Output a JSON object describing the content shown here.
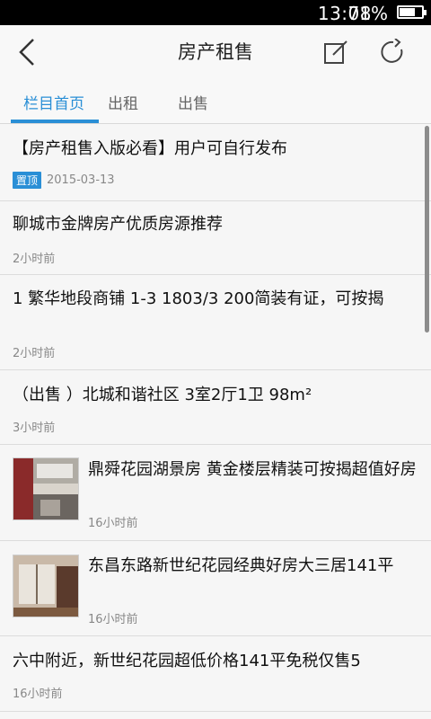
{
  "status_bar": {
    "time": "13:08",
    "battery_percent": "71%",
    "battery_level": 0.71
  },
  "app_bar": {
    "title": "房产租售",
    "back_icon": "back-arrow-icon",
    "compose_icon": "compose-icon",
    "refresh_icon": "refresh-icon"
  },
  "tabs": [
    {
      "label": "栏目首页",
      "active": true
    },
    {
      "label": "出租",
      "active": false
    },
    {
      "label": "出售",
      "active": false
    }
  ],
  "posts": [
    {
      "title": "【房产租售入版必看】用户可自行发布",
      "badge": "置顶",
      "time": "2015-03-13"
    },
    {
      "title": "聊城市金牌房产优质房源推荐",
      "time": "2小时前"
    },
    {
      "title": "1 繁华地段商铺  1-3 1803/3 200简装有证，可按揭",
      "time": "2小时前"
    },
    {
      "title": "（出售 ）北城和谐社区 3室2厅1卫 98m²",
      "time": "3小时前"
    },
    {
      "title": "鼎舜花园湖景房 黄金楼层精装可按揭超值好房",
      "time": "16小时前"
    },
    {
      "title": "东昌东路新世纪花园经典好房大三居141平",
      "time": "16小时前"
    },
    {
      "title": "六中附近，新世纪花园超低价格141平免税仅售5",
      "time": "16小时前"
    }
  ],
  "colors": {
    "accent": "#2a8fd6",
    "status_bar": "#000000"
  }
}
